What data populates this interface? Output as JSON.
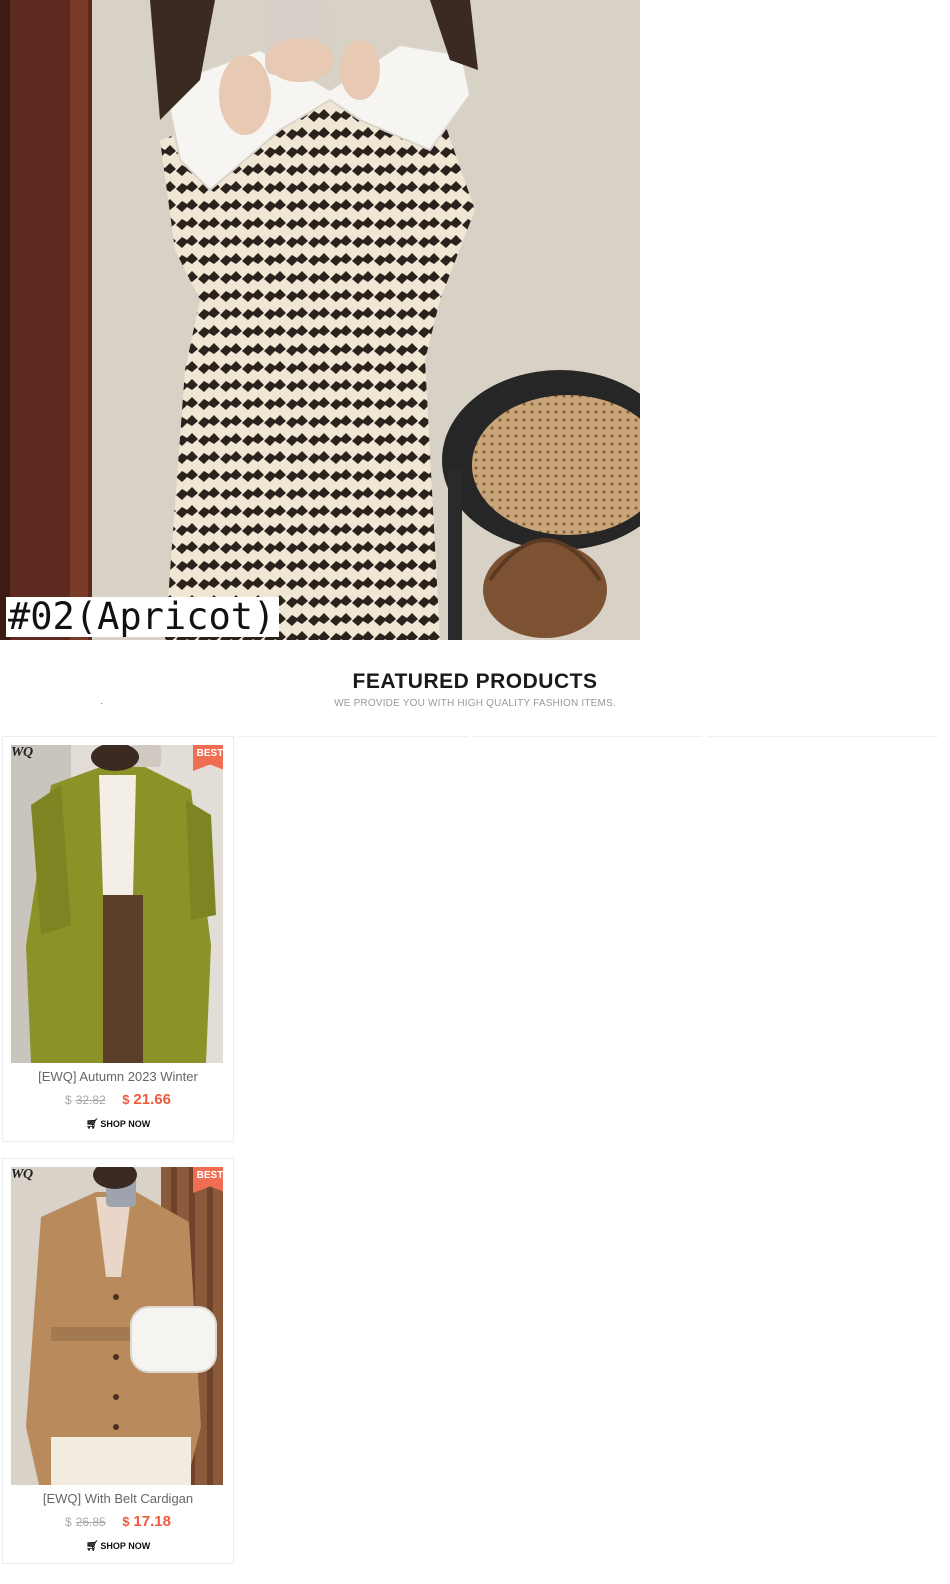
{
  "hero": {
    "variant_label": "#02(Apricot)"
  },
  "featured": {
    "title": "FEATURED PRODUCTS",
    "subtitle": "WE PROVIDE YOU WITH HIGH QUALITY FASHION ITEMS."
  },
  "products": [
    {
      "brand": "WQ",
      "badge": "BEST",
      "title": "[EWQ] Autumn 2023 Winter",
      "currency": "$",
      "old_price": "32.82",
      "new_price": "21.66",
      "cta": "SHOP NOW"
    },
    {
      "brand": "WQ",
      "badge": "BEST",
      "title": "[EWQ] With Belt Cardigan",
      "currency": "$",
      "old_price": "26.85",
      "new_price": "17.18",
      "cta": "SHOP NOW"
    }
  ],
  "colors": {
    "accent": "#ef5a3c",
    "badge": "#ef6d51",
    "muted_text": "#9a9a9a"
  }
}
